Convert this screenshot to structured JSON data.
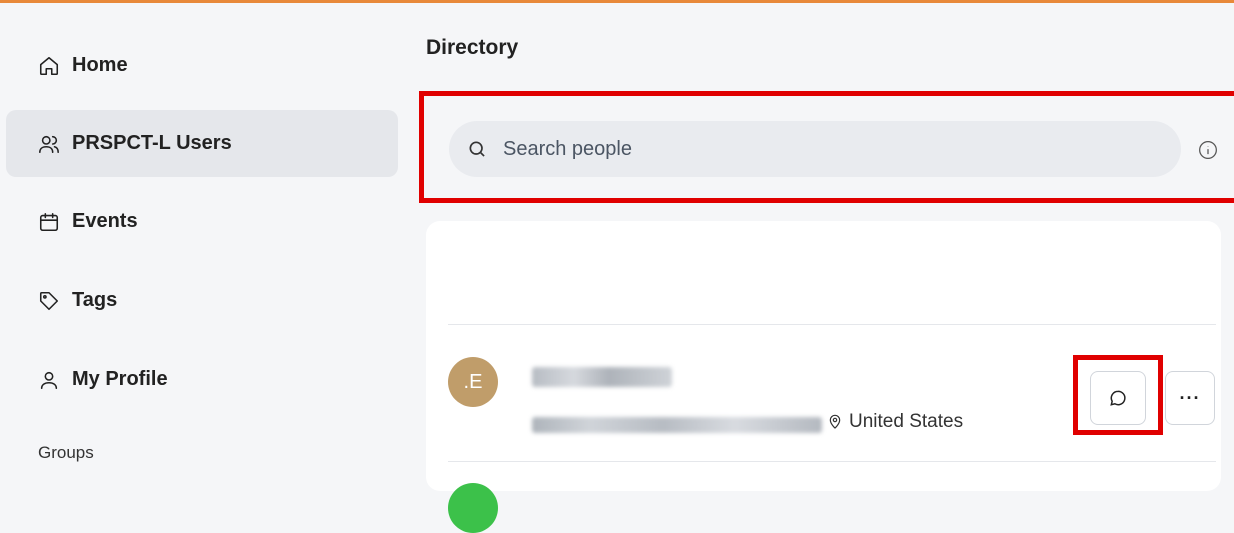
{
  "sidebar": {
    "items": [
      {
        "label": "Home",
        "icon": "home-icon"
      },
      {
        "label": "PRSPCT-L Users",
        "icon": "users-icon",
        "active": true
      },
      {
        "label": "Events",
        "icon": "calendar-icon"
      },
      {
        "label": "Tags",
        "icon": "tag-icon"
      },
      {
        "label": "My Profile",
        "icon": "user-icon"
      }
    ],
    "groups_label": "Groups"
  },
  "main": {
    "title": "Directory",
    "search": {
      "placeholder": "Search people",
      "value": ""
    },
    "people": [
      {
        "initials": ".E",
        "location": "United States",
        "avatar_color": "#c09d6a"
      }
    ]
  },
  "colors": {
    "accent_line": "#e8893a",
    "highlight": "#e00000",
    "next_avatar": "#3cc14a"
  }
}
